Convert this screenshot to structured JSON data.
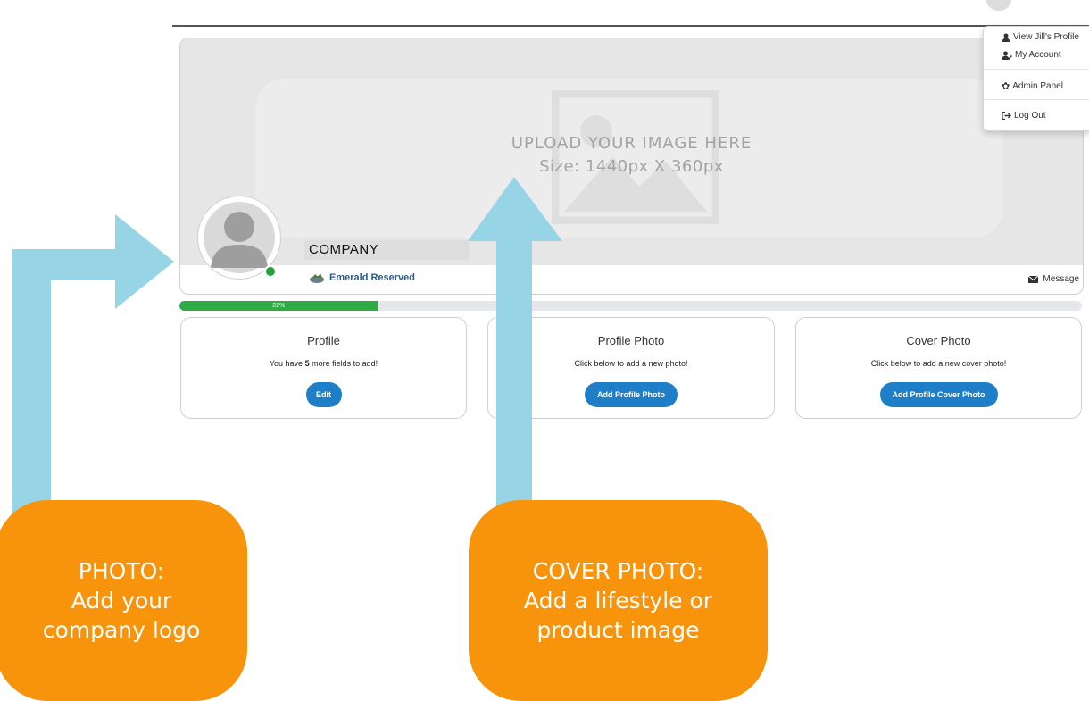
{
  "cover": {
    "upload_title": "UPLOAD YOUR IMAGE HERE",
    "upload_size": "Size: 1440px X 360px"
  },
  "profile": {
    "company_name": "COMPANY",
    "membership_label": "Emerald Reserved",
    "message_label": "Message"
  },
  "progress": {
    "percent": 22,
    "label": "22%",
    "color": "#2faa44"
  },
  "cards": [
    {
      "title": "Profile",
      "text_prefix": "You have ",
      "count": "5",
      "text_suffix": " more fields to add!",
      "button": "Edit"
    },
    {
      "title": "Profile Photo",
      "text": "Click below to add a new photo!",
      "button": "Add Profile Photo"
    },
    {
      "title": "Cover Photo",
      "text": "Click below to add a new cover photo!",
      "button": "Add Profile Cover Photo"
    }
  ],
  "dropdown": {
    "items": [
      {
        "label": "View Jill's Profile",
        "icon": "user-icon"
      },
      {
        "label": "My Account",
        "icon": "user-edit-icon"
      },
      {
        "label": "Admin Panel",
        "icon": "gear-icon"
      },
      {
        "label": "Log Out",
        "icon": "logout-icon"
      }
    ]
  },
  "callouts": {
    "photo": [
      "PHOTO:",
      "Add your",
      "company logo"
    ],
    "cover": [
      "COVER PHOTO:",
      "Add a lifestyle or",
      "product image"
    ]
  },
  "colors": {
    "accent_blue": "#1e7ec8",
    "callout_orange": "#f7940b",
    "arrow_blue": "#97d5e6",
    "online_green": "#22a33a"
  }
}
